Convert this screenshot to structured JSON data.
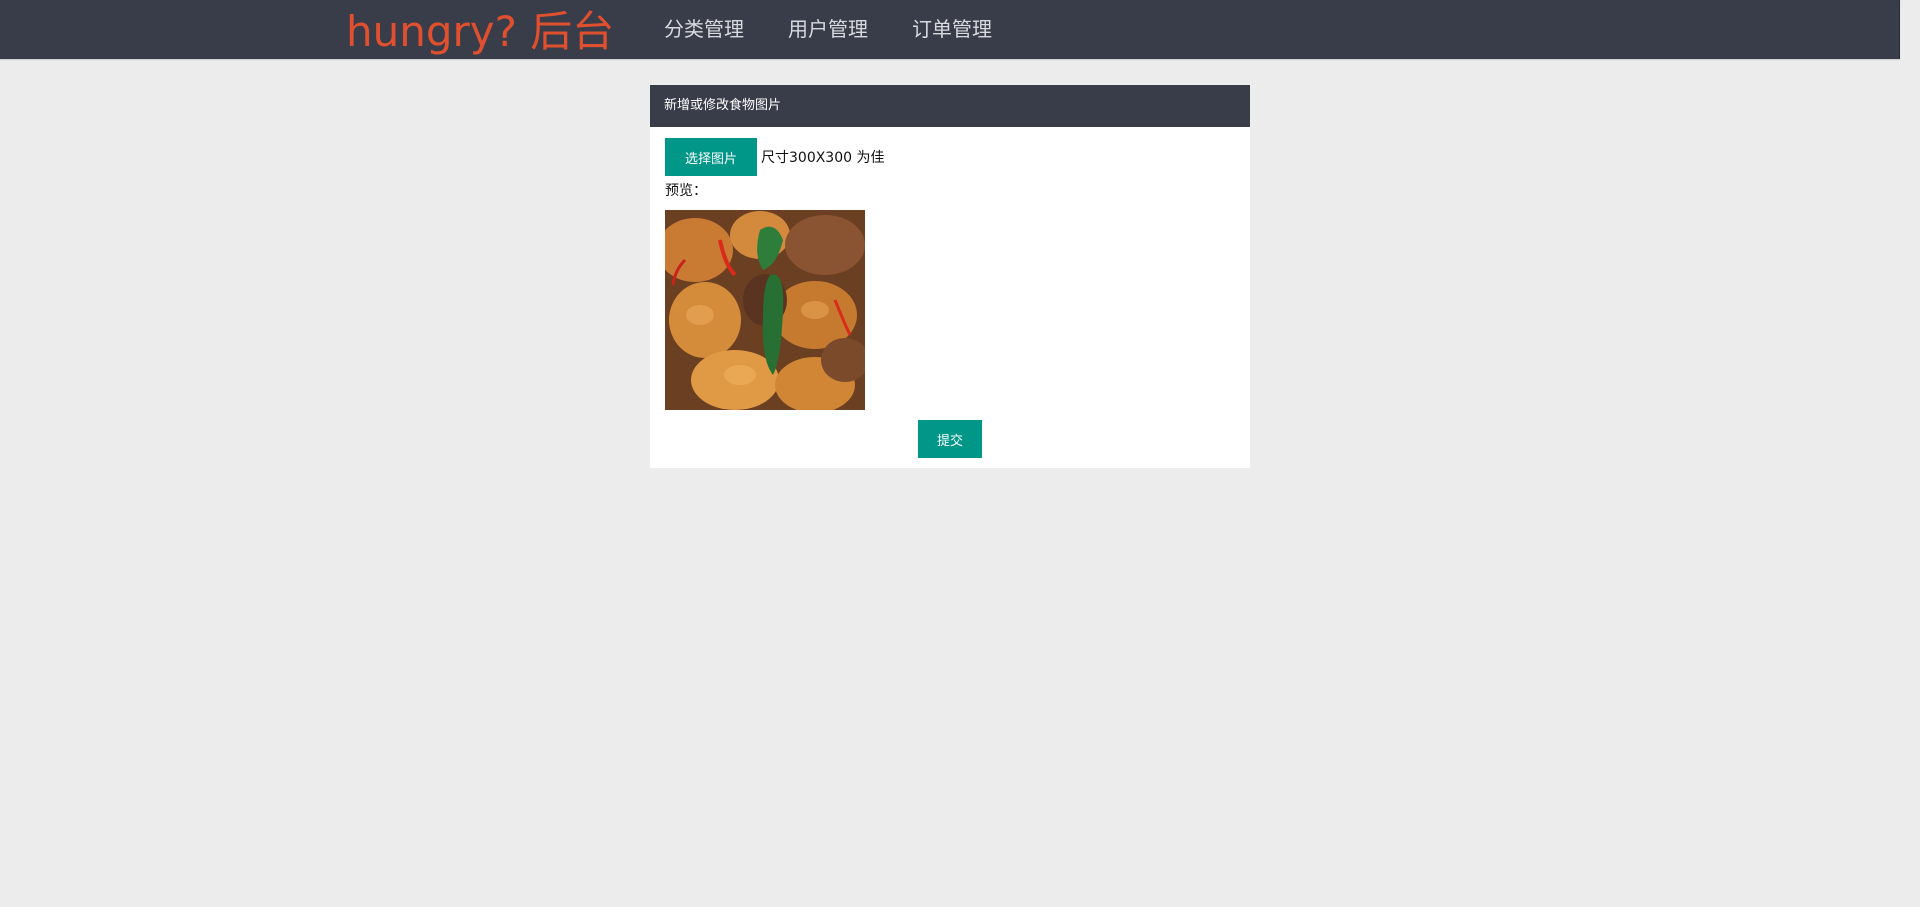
{
  "header": {
    "logo_text": "hungry? 后台",
    "nav": [
      {
        "label": "分类管理"
      },
      {
        "label": "用户管理"
      },
      {
        "label": "订单管理"
      }
    ],
    "colors": {
      "bar": "#393d49",
      "logo": "#e0502f",
      "nav_text": "#d8dae0"
    }
  },
  "panel": {
    "title": "新增或修改食物图片",
    "select_button": "选择图片",
    "size_hint": "尺寸300X300 为佳",
    "preview_label": "预览：",
    "preview_image": "food-photo",
    "submit_button": "提交",
    "accent_color": "#009688"
  }
}
